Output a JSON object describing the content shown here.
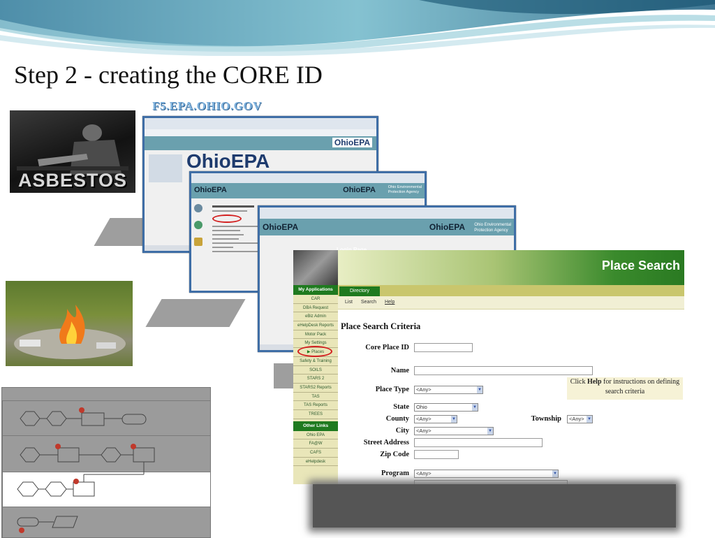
{
  "slide": {
    "title": "Step 2 - creating the CORE ID",
    "url_caption": "F5.EPA.OHIO.GOV"
  },
  "photos": {
    "asbestos_text": "ASBESTOS"
  },
  "screens": {
    "logo": "OhioEPA",
    "agency_line1": "Ohio Environmental",
    "agency_line2": "Protection Agency",
    "login_label": "Login Page"
  },
  "place_search": {
    "header_title": "Place Search",
    "tab_directory": "Directory",
    "subnav": [
      "List",
      "Search",
      "Help"
    ],
    "section_title": "Place Search Criteria",
    "sidebar_head": "My Applications",
    "sidebar_items": [
      "CAR",
      "DBA Request",
      "eBiz Admin",
      "eHelpDesk Reports",
      "Motor Pack",
      "My Settings",
      "Places",
      "Safety & Training",
      "SOILS",
      "STARS 2",
      "STARS2 Reports",
      "TAS",
      "TAS Reports",
      "TREES"
    ],
    "sidebar_head2": "Other Links",
    "sidebar_items2": [
      "Ohio EPA",
      "FA@W",
      "CAFS",
      "eHelpdesk"
    ],
    "labels": {
      "core_place_id": "Core Place ID",
      "name": "Name",
      "place_type": "Place Type",
      "state": "State",
      "county": "County",
      "township": "Township",
      "city": "City",
      "street_address": "Street Address",
      "zip_code": "Zip Code",
      "program": "Program"
    },
    "values": {
      "place_type": "<Any>",
      "state": "Ohio",
      "county": "<Any>",
      "township": "<Any>",
      "city": "<Any>",
      "program": "<Any>"
    },
    "help": {
      "prefix": "Click ",
      "bold": "Help",
      "suffix": " for instructions on defining search criteria"
    }
  }
}
